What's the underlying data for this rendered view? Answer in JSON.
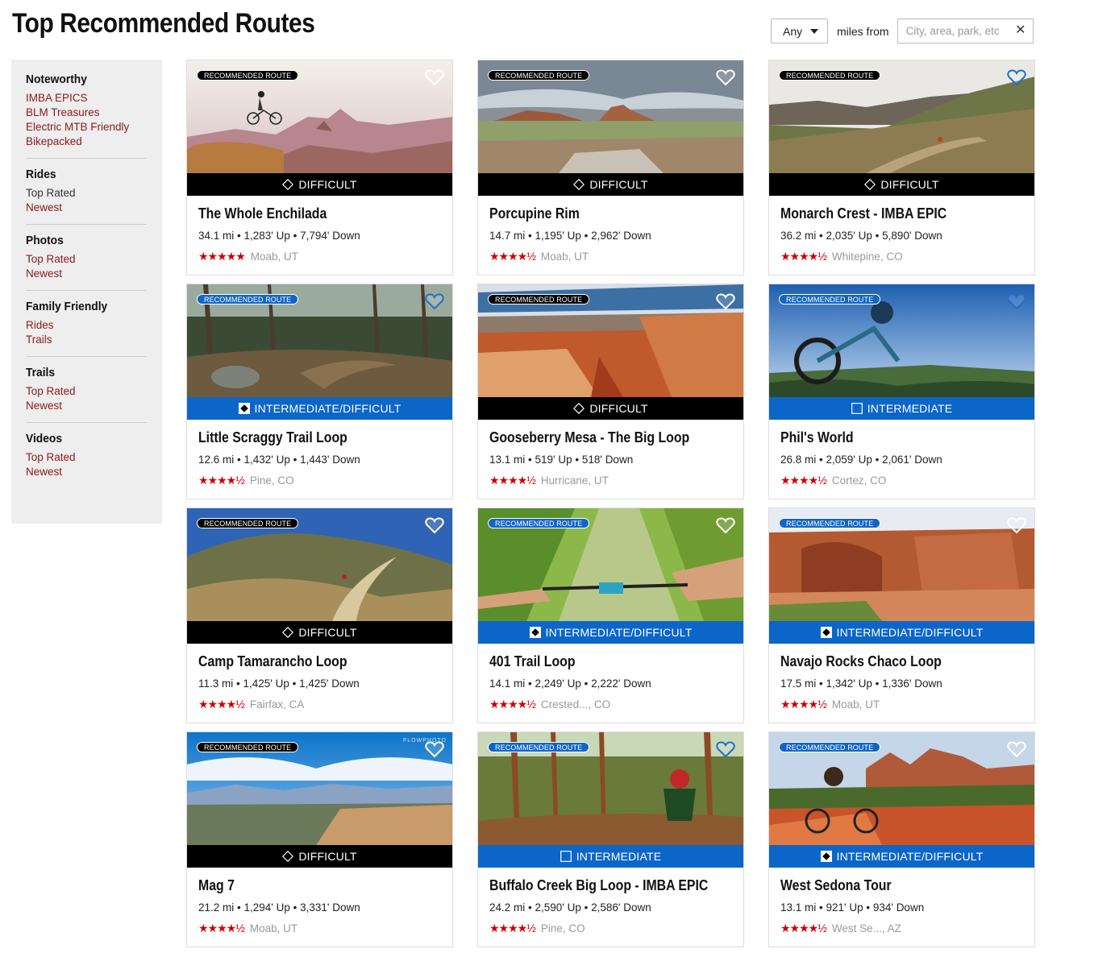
{
  "header": {
    "title": "Top Recommended Routes",
    "distance_value": "Any",
    "miles_from_label": "miles from",
    "location_placeholder": "City, area, park, etc",
    "clear_label": "✕"
  },
  "sidebar": {
    "groups": [
      {
        "heading": "Noteworthy",
        "links": [
          "IMBA EPICS",
          "BLM Treasures",
          "Electric MTB Friendly",
          "Bikepacked"
        ]
      },
      {
        "heading": "Rides",
        "links": [
          "Top Rated",
          "Newest"
        ]
      },
      {
        "heading": "Photos",
        "links": [
          "Top Rated",
          "Newest"
        ]
      },
      {
        "heading": "Family Friendly",
        "links": [
          "Rides",
          "Trails"
        ]
      },
      {
        "heading": "Trails",
        "links": [
          "Top Rated",
          "Newest"
        ]
      },
      {
        "heading": "Videos",
        "links": [
          "Top Rated",
          "Newest"
        ]
      }
    ]
  },
  "colors": {
    "link": "#8b1a1a",
    "difficult": "#000000",
    "intermediate": "#0c66c8",
    "star": "#cc0000"
  },
  "badge_label": "RECOMMENDED ROUTE",
  "cards": [
    {
      "title": "The Whole Enchilada",
      "stats": "34.1 mi • 1,283' Up • 7,794' Down",
      "stars": "★★★★★",
      "rating": 5.0,
      "location": "Moab, UT",
      "difficulty": "DIFFICULT",
      "level": "difficult",
      "badge_style": "black",
      "heart_style": "light",
      "scene": "canyon"
    },
    {
      "title": "Porcupine Rim",
      "stats": "14.7 mi • 1,195' Up • 2,962' Down",
      "stars": "★★★★½",
      "rating": 4.5,
      "location": "Moab, UT",
      "difficulty": "DIFFICULT",
      "level": "difficult",
      "badge_style": "black",
      "heart_style": "light",
      "scene": "mesa"
    },
    {
      "title": "Monarch Crest - IMBA EPIC",
      "stats": "36.2 mi • 2,035' Up • 5,890' Down",
      "stars": "★★★★½",
      "rating": 4.5,
      "location": "Whitepine, CO",
      "difficulty": "DIFFICULT",
      "level": "difficult",
      "badge_style": "black",
      "heart_style": "blue",
      "scene": "ridge"
    },
    {
      "title": "Little Scraggy Trail Loop",
      "stats": "12.6 mi • 1,432' Up • 1,443' Down",
      "stars": "★★★★½",
      "rating": 4.5,
      "location": "Pine, CO",
      "difficulty": "INTERMEDIATE/DIFFICULT",
      "level": "int-diff",
      "badge_style": "blue",
      "heart_style": "blue",
      "scene": "forest"
    },
    {
      "title": "Gooseberry Mesa - The Big Loop",
      "stats": "13.1 mi • 519' Up • 518' Down",
      "stars": "★★★★½",
      "rating": 4.5,
      "location": "Hurricane, UT",
      "difficulty": "DIFFICULT",
      "level": "difficult",
      "badge_style": "black",
      "heart_style": "light",
      "scene": "redrock"
    },
    {
      "title": "Phil's World",
      "stats": "26.8 mi • 2,059' Up • 2,061' Down",
      "stars": "★★★★½",
      "rating": 4.5,
      "location": "Cortez, CO",
      "difficulty": "INTERMEDIATE",
      "level": "intermediate",
      "badge_style": "blue",
      "heart_style": "blue",
      "scene": "sky"
    },
    {
      "title": "Camp Tamarancho Loop",
      "stats": "11.3 mi • 1,425' Up • 1,425' Down",
      "stars": "★★★★½",
      "rating": 4.5,
      "location": "Fairfax, CA",
      "difficulty": "DIFFICULT",
      "level": "difficult",
      "badge_style": "black",
      "heart_style": "light",
      "scene": "hills"
    },
    {
      "title": "401 Trail Loop",
      "stats": "14.1 mi • 2,249' Up • 2,222' Down",
      "stars": "★★★★½",
      "rating": 4.5,
      "location": "Crested..., CO",
      "difficulty": "INTERMEDIATE/DIFFICULT",
      "level": "int-diff",
      "badge_style": "blue",
      "heart_style": "light",
      "scene": "meadow"
    },
    {
      "title": "Navajo Rocks Chaco Loop",
      "stats": "17.5 mi • 1,342' Up • 1,336' Down",
      "stars": "★★★★½",
      "rating": 4.5,
      "location": "Moab, UT",
      "difficulty": "INTERMEDIATE/DIFFICULT",
      "level": "int-diff",
      "badge_style": "blue",
      "heart_style": "light",
      "scene": "arch"
    },
    {
      "title": "Mag 7",
      "stats": "21.2 mi • 1,294' Up • 3,331' Down",
      "stars": "★★★★½",
      "rating": 4.5,
      "location": "Moab, UT",
      "difficulty": "DIFFICULT",
      "level": "difficult",
      "badge_style": "black",
      "heart_style": "light",
      "scene": "overlook",
      "watermark": "FLOWPHOTO"
    },
    {
      "title": "Buffalo Creek Big Loop - IMBA EPIC",
      "stats": "24.2 mi • 2,590' Up • 2,586' Down",
      "stars": "★★★★½",
      "rating": 4.5,
      "location": "Pine, CO",
      "difficulty": "INTERMEDIATE",
      "level": "intermediate",
      "badge_style": "blue",
      "heart_style": "blue",
      "scene": "pines"
    },
    {
      "title": "West Sedona Tour",
      "stats": "13.1 mi • 921' Up • 934' Down",
      "stars": "★★★★½",
      "rating": 4.5,
      "location": "West Se..., AZ",
      "difficulty": "INTERMEDIATE/DIFFICULT",
      "level": "int-diff",
      "badge_style": "blue",
      "heart_style": "light",
      "scene": "sedona"
    }
  ]
}
